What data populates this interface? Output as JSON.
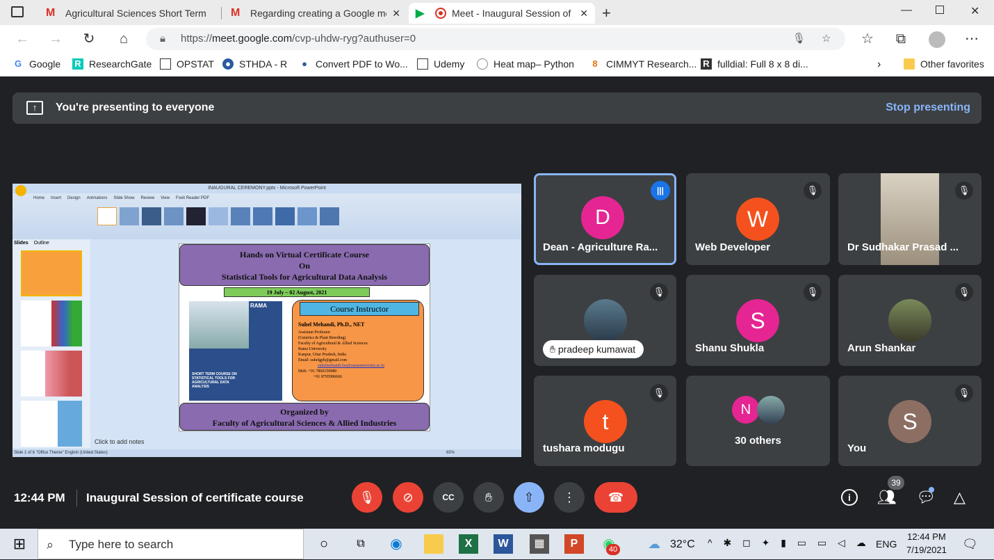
{
  "browser": {
    "tabs": [
      {
        "title": "Agricultural Sciences Short Term",
        "icon": "gmail-icon"
      },
      {
        "title": "Regarding creating a Google me",
        "icon": "gmail-icon"
      },
      {
        "title": "Meet - Inaugural Session of",
        "icon": "meet-icon"
      }
    ],
    "url_prefix": "https://",
    "url_host": "meet.google.com",
    "url_path": "/cvp-uhdw-ryg?authuser=0",
    "favorites": [
      {
        "label": "Google"
      },
      {
        "label": "ResearchGate"
      },
      {
        "label": "OPSTAT"
      },
      {
        "label": "STHDA - R"
      },
      {
        "label": "Convert PDF to Wo..."
      },
      {
        "label": "Udemy"
      },
      {
        "label": "Heat map– Python"
      },
      {
        "label": "CIMMYT Research..."
      },
      {
        "label": "fulldial: Full 8 x 8 di..."
      },
      {
        "label": "Other favorites"
      }
    ]
  },
  "meet": {
    "presenting_text": "You're presenting to everyone",
    "stop_label": "Stop presenting",
    "participants": [
      {
        "name": "Dean - Agriculture Ra...",
        "initial": "D",
        "color": "#e52592"
      },
      {
        "name": "Web Developer",
        "initial": "W",
        "color": "#f4511e"
      },
      {
        "name": "Dr Sudhakar Prasad ...",
        "initial": "",
        "color": "#777"
      },
      {
        "name": "pradeep kumawat",
        "initial": "",
        "color": "#556"
      },
      {
        "name": "Shanu Shukla",
        "initial": "S",
        "color": "#e52592"
      },
      {
        "name": "Arun Shankar",
        "initial": "",
        "color": "#665"
      },
      {
        "name": "tushara modugu",
        "initial": "t",
        "color": "#f4511e"
      },
      {
        "name": "30 others",
        "initial": "N",
        "color": "#e52592"
      },
      {
        "name": "You",
        "initial": "S",
        "color": "#8d6e63"
      }
    ],
    "time": "12:44 PM",
    "meeting_title": "Inaugural Session of certificate course",
    "people_count": "39"
  },
  "slide": {
    "window_title": "INAUGURAL CEREMONY.pptx - Microsoft PowerPoint",
    "tabs": [
      "Home",
      "Insert",
      "Design",
      "Animations",
      "Slide Show",
      "Review",
      "View",
      "Foxit Reader PDF"
    ],
    "panel_tabs": [
      "Slides",
      "Outline"
    ],
    "title_line1": "Hands on Virtual Certificate Course",
    "title_line2": "On",
    "title_line3": "Statistical Tools for Agricultural Data Analysis",
    "dates": "19 July – 02 August, 2021",
    "instructor_heading": "Course Instructor",
    "instructor_name": "Suhel Mehandi, Ph.D., NET",
    "instructor_lines": [
      "Assistant Professor",
      "(Genetics & Plant Breeding)",
      "Faculty of Agricultural & Allied Sciences",
      "Rama University",
      "Kanpur, Uttar Pradesh, India"
    ],
    "email1": "Email: suhelgpb@gmail.com",
    "email2": "suhelmehandi.fas@ramauniversity.ac.in",
    "mob1": "Mob: +91 7860150980",
    "mob2": "+91 8795996666",
    "organized": "Organized by",
    "organizer": "Faculty of Agricultural Sciences & Allied Industries",
    "notes": "Click to add notes",
    "status": "Slide 1 of 6   \"Office Theme\"   English (United States)",
    "zoom": "65%",
    "poster_text": "SHORT TERM COURSE ON STATISTICAL TOOLS FOR AGRICULTURAL DATA ANALYSIS",
    "logo_text": "RAMA"
  },
  "taskbar": {
    "search_placeholder": "Type here to search",
    "weather": "32°C",
    "lang": "ENG",
    "time": "12:44 PM",
    "date": "7/19/2021",
    "whatsapp_badge": "40"
  }
}
